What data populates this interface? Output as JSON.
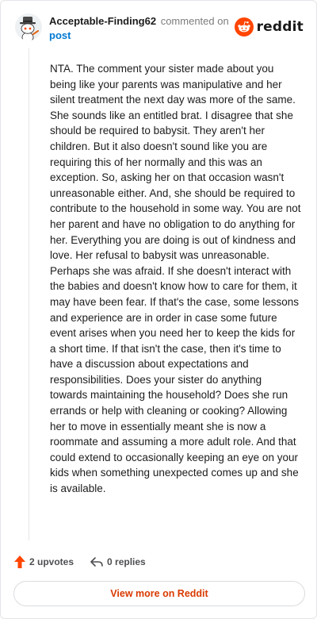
{
  "header": {
    "username": "Acceptable-Finding62",
    "action": "commented on",
    "post_link": "post",
    "brand": "reddit"
  },
  "comment": {
    "text": "NTA. The comment your sister made about you being like your parents was manipulative and her silent treatment the next day was more of the same. She sounds like an entitled brat. I disagree that she should be required to babysit. They aren't her children. But it also doesn't sound like you are requiring this of her normally and this was an exception. So, asking her on that occasion wasn't unreasonable either. And, she should be required to contribute to the household in some way. You are not her parent and have no obligation to do anything for her. Everything you are doing is out of kindness and love. Her refusal to babysit was unreasonable. Perhaps she was afraid. If she doesn't interact with the babies and doesn't know how to care for them, it may have been fear. If that's the case, some lessons and experience are in order in case some future event arises when you need her to keep the kids for a short time. If that isn't the case, then it's time to have a discussion about expectations and responsibilities. Does your sister do anything towards maintaining the household? Does she run errands or help with cleaning or cooking? Allowing her to move in essentially meant she is now a roommate and assuming a more adult role. And that could extend to occasionally keeping an eye on your kids when something unexpected comes up and she is available."
  },
  "actions": {
    "upvotes": "2 upvotes",
    "replies": "0 replies"
  },
  "footer": {
    "view_more": "View more on Reddit"
  },
  "colors": {
    "accent": "#ff4500",
    "link": "#0079d3",
    "view_more": "#d93a00"
  },
  "icons": {
    "avatar": "snoo-avatar-icon",
    "brand": "reddit-logo-icon",
    "upvote": "upvote-arrow-icon",
    "reply": "reply-arrow-icon"
  }
}
